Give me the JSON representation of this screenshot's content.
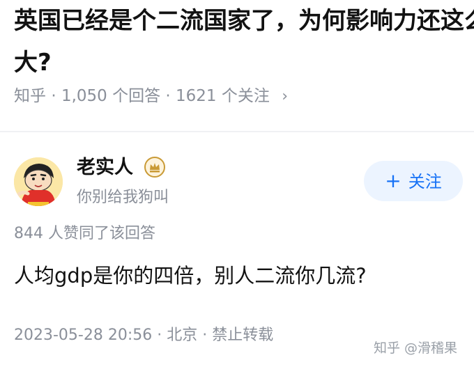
{
  "question": {
    "title": "英国已经是个二流国家了，为何影响力还这么大?",
    "source": "知乎",
    "answer_count": "1,050 个回答",
    "follower_count": "1621 个关注",
    "separator": "·",
    "chevron": "›"
  },
  "answer": {
    "author": {
      "name": "老实人",
      "bio": "你别给我狗叫",
      "badge_icon": "crown-badge-icon",
      "avatar_icon": "cartoon-avatar-icon"
    },
    "follow_button": {
      "plus": "+",
      "label": "关注"
    },
    "votes": "844 人赞同了该回答",
    "text": "人均gdp是你的四倍，别人二流你几流?",
    "footer": {
      "date": "2023-05-28 20:56",
      "location": "北京",
      "rights": "禁止转载",
      "separator": "·"
    }
  },
  "watermark": "知乎 @滑稽果",
  "colors": {
    "accent": "#1772f6",
    "follow_bg": "#ecf4ff",
    "meta_text": "#8a8f99",
    "badge_gold": "#c99a35"
  }
}
